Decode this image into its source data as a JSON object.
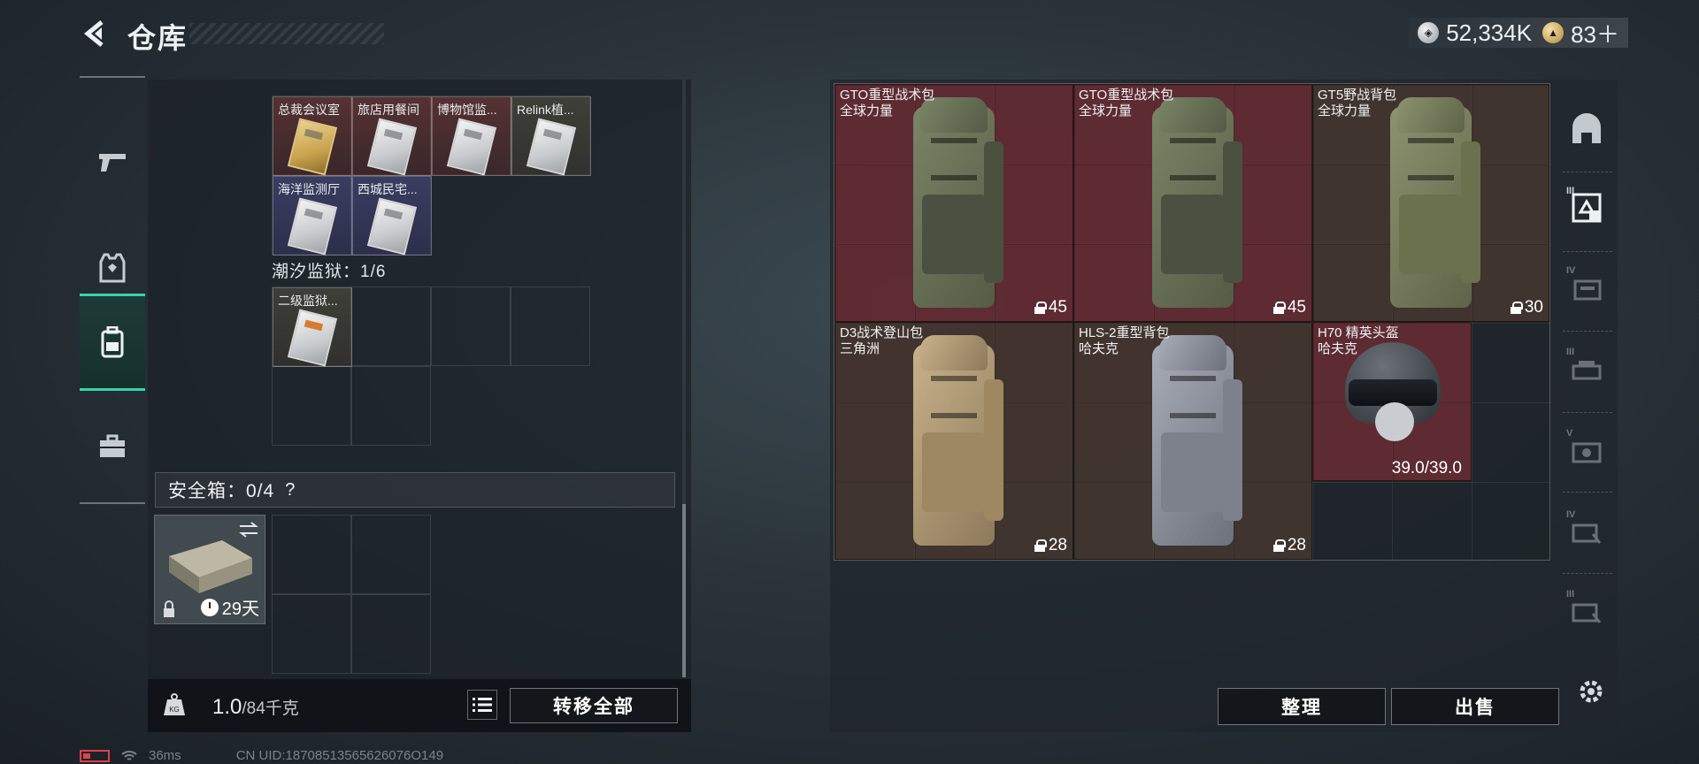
{
  "header": {
    "title": "仓库",
    "currency": [
      {
        "icon": "silver-coin-icon",
        "value": "52,334K"
      },
      {
        "icon": "gold-coin-icon",
        "value": "83＋"
      }
    ]
  },
  "left_rail": {
    "items": [
      {
        "icon": "pistol-icon"
      },
      {
        "icon": "armor-vest-icon"
      },
      {
        "icon": "backpack-icon",
        "active": true
      },
      {
        "icon": "briefcase-icon"
      }
    ]
  },
  "keys_section": {
    "row1": [
      "总裁会议室",
      "旅店用餐间",
      "博物馆监...",
      "Relink植..."
    ],
    "row2": [
      "海洋监测厅",
      "西城民宅..."
    ],
    "prison_label": "潮汐监狱：1/6",
    "prison_items": [
      "二级监狱..."
    ]
  },
  "safe": {
    "label": "安全箱：0/4",
    "help": "?",
    "days": "29天"
  },
  "footer_left": {
    "weight_current": "1.0",
    "weight_cap": "/84千克",
    "transfer_label": "转移全部"
  },
  "items": [
    {
      "name": "GTO重型战术包",
      "sub": "全球力量",
      "count": "45"
    },
    {
      "name": "GTO重型战术包",
      "sub": "全球力量",
      "count": "45"
    },
    {
      "name": "GT5野战背包",
      "sub": "全球力量",
      "count": "30"
    },
    {
      "name": "D3战术登山包",
      "sub": "三角洲",
      "count": "28"
    },
    {
      "name": "HLS-2重型背包",
      "sub": "哈夫克",
      "count": "28"
    },
    {
      "name": "H70 精英头盔",
      "sub": "哈夫克",
      "durability": "39.0/39.0"
    }
  ],
  "right_rail": {
    "items": [
      {
        "icon": "helmet-slot-icon",
        "num": ""
      },
      {
        "icon": "armor-slot-icon",
        "num": "III"
      },
      {
        "icon": "tier-iv-icon",
        "num": "IV"
      },
      {
        "icon": "tier-iii-icon",
        "num": "III"
      },
      {
        "icon": "tier-v-icon",
        "num": "V"
      },
      {
        "icon": "tier-iv-icon",
        "num": "IV"
      },
      {
        "icon": "tier-iii-icon",
        "num": "III"
      }
    ]
  },
  "footer_right": {
    "sort_label": "整理",
    "sell_label": "出售"
  },
  "status_bar": {
    "ping": "36ms",
    "uid": "CN UID:18708513565626076O149"
  },
  "colors": {
    "accent": "#39d3a8",
    "item_red": "#762e34",
    "item_brown": "#4c3a30"
  }
}
